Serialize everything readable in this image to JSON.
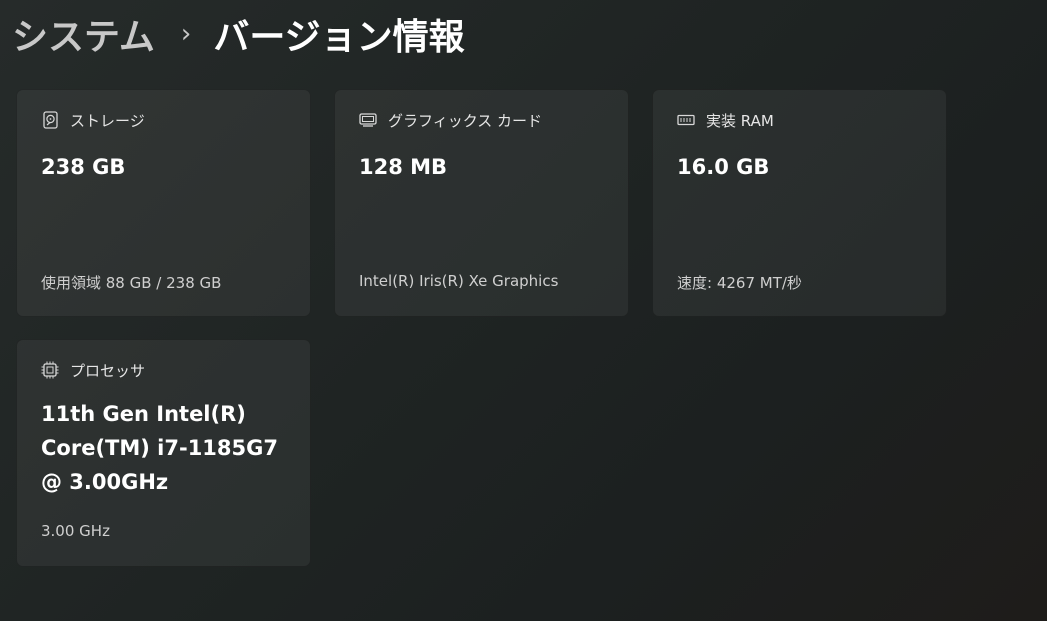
{
  "breadcrumb": {
    "parent": "システム",
    "separator": "›",
    "current": "バージョン情報"
  },
  "cards": [
    {
      "icon": "storage-icon",
      "label": "ストレージ",
      "value": "238 GB",
      "sub": "使用領域 88 GB / 238 GB"
    },
    {
      "icon": "graphics-card-icon",
      "label": "グラフィックス カード",
      "value": "128 MB",
      "sub": "Intel(R) Iris(R) Xe Graphics"
    },
    {
      "icon": "ram-icon",
      "label": "実装 RAM",
      "value": "16.0 GB",
      "sub": "速度: 4267 MT/秒"
    },
    {
      "icon": "processor-icon",
      "label": "プロセッサ",
      "value": "11th Gen Intel(R) Core(TM) i7-1185G7 @ 3.00GHz",
      "sub": "3.00 GHz"
    }
  ],
  "colors": {
    "background": "#222726",
    "card": "#2b302f",
    "text_primary": "#ffffff",
    "text_secondary": "#cfcfcf"
  }
}
